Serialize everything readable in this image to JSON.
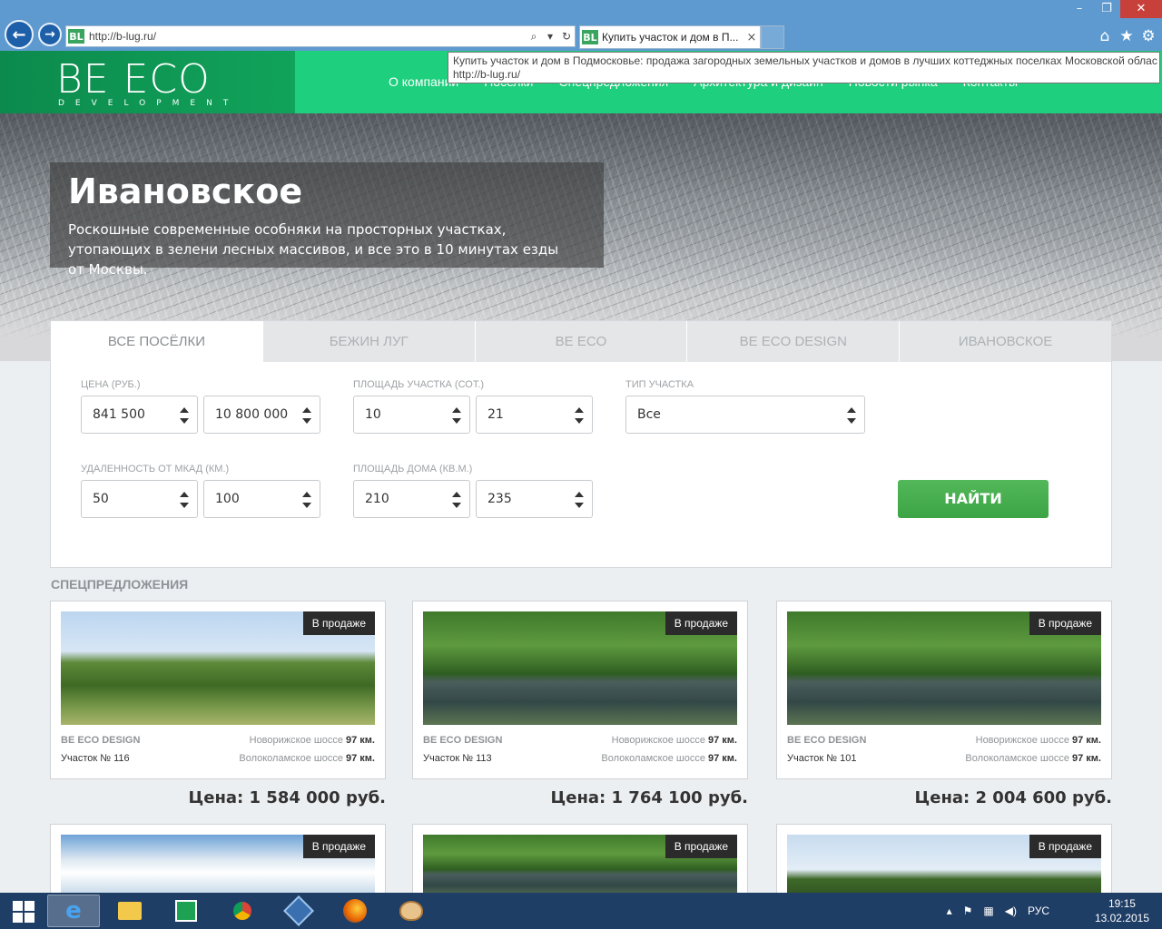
{
  "browser": {
    "url": "http://b-lug.ru/",
    "favicon_text": "BL",
    "tab_title": "Купить участок и дом в П...",
    "tooltip_line1": "Купить участок и дом в Подмосковье: продажа загородных земельных участков и домов в лучших коттеджных поселках Московской облас",
    "tooltip_line2": "http://b-lug.ru/"
  },
  "site": {
    "logo": "BE ECO",
    "logo_sub": "DEVELOPMENT",
    "menu": [
      "О компании",
      "Поселки",
      "Спецпредложения",
      "Архитектура и дизайн",
      "Новости рынка",
      "Контакты"
    ]
  },
  "hero": {
    "title": "Ивановское",
    "description": "Роскошные современные особняки на просторных участках, утопающих в зелени лесных массивов, и все это в 10 минутах езды от Москвы."
  },
  "filter": {
    "tabs": [
      "ВСЕ ПОСЁЛКИ",
      "БЕЖИН ЛУГ",
      "BE ECO",
      "BE ECO DESIGN",
      "ИВАНОВСКОЕ"
    ],
    "price_label": "ЦЕНА (РУБ.)",
    "price_from": "841 500",
    "price_to": "10 800 000",
    "plot_label": "ПЛОЩАДЬ УЧАСТКА (СОТ.)",
    "plot_from": "10",
    "plot_to": "21",
    "type_label": "ТИП УЧАСТКА",
    "type_value": "Все",
    "distance_label": "УДАЛЕННОСТЬ ОТ МКАД (КМ.)",
    "distance_from": "50",
    "distance_to": "100",
    "house_label": "ПЛОЩАДЬ ДОМА (КВ.М.)",
    "house_from": "210",
    "house_to": "235",
    "find_label": "НАЙТИ"
  },
  "offers": {
    "title": "СПЕЦПРЕДЛОЖЕНИЯ",
    "badge": "В продаже",
    "road1": "Новорижское шоссе",
    "road2": "Волоколамское шоссе",
    "items": [
      {
        "village": "BE ECO DESIGN",
        "lot": "Участок № 116",
        "km1": "97 км.",
        "km2": "97 км.",
        "price": "Цена: 1 584 000 руб."
      },
      {
        "village": "BE ECO DESIGN",
        "lot": "Участок № 113",
        "km1": "97 км.",
        "km2": "97 км.",
        "price": "Цена: 1 764 100 руб."
      },
      {
        "village": "BE ECO DESIGN",
        "lot": "Участок № 101",
        "km1": "97 км.",
        "km2": "97 км.",
        "price": "Цена: 2 004 600 руб."
      }
    ]
  },
  "taskbar": {
    "lang": "РУС",
    "time": "19:15",
    "date": "13.02.2015"
  }
}
